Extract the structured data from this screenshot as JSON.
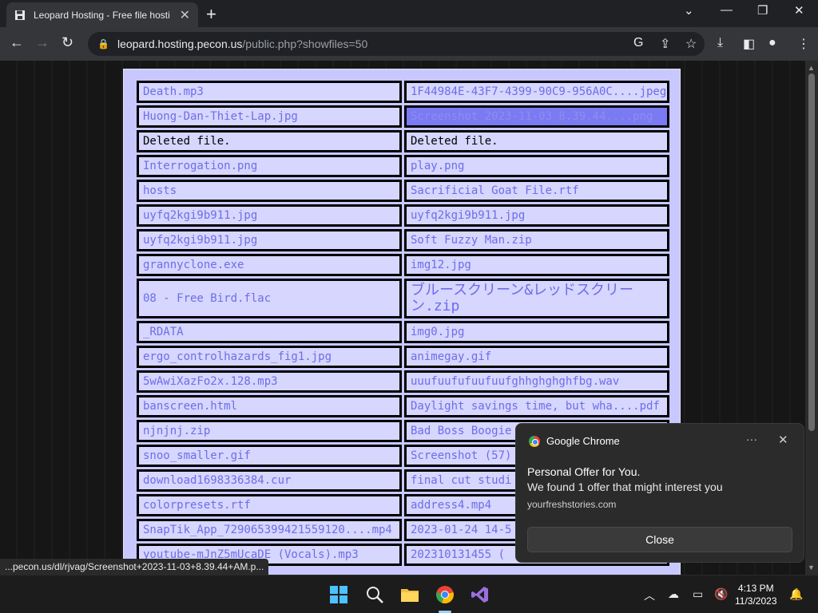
{
  "browser": {
    "tab_title": "Leopard Hosting - Free file hosti",
    "url_host": "leopard.hosting.pecon.us",
    "url_path": "/public.php?showfiles=50",
    "status_url": "...pecon.us/dl/rjvag/Screenshot+2023-11-03+8.39.44+AM.p..."
  },
  "files": {
    "left": [
      "Death.mp3",
      "Huong-Dan-Thiet-Lap.jpg",
      "Deleted file.",
      "Interrogation.png",
      "hosts",
      "uyfq2kgi9b911.jpg",
      "uyfq2kgi9b911.jpg",
      "grannyclone.exe",
      "08 - Free Bird.flac",
      "_RDATA",
      "ergo_controlhazards_fig1.jpg",
      "5wAwiXazFo2x.128.mp3",
      "banscreen.html",
      "njnjnj.zip",
      "snoo_smaller.gif",
      "download1698336384.cur",
      "colorpresets.rtf",
      "SnapTik_App_729065399421559120....mp4",
      "youtube-mJnZ5mUcaDE (Vocals).mp3"
    ],
    "right": [
      "1F44984E-43F7-4399-90C9-956A0C....jpeg",
      "Screenshot 2023-11-03 8.39.44....png",
      "Deleted file.",
      "play.png",
      "Sacrificial Goat File.rtf",
      "uyfq2kgi9b911.jpg",
      "Soft Fuzzy Man.zip",
      "img12.jpg",
      "ブルースクリーン&レッドスクリーン.zip",
      "img0.jpg",
      "animegay.gif",
      "uuufuufufuufuufghhghghghfbg.wav",
      "Daylight savings time, but wha....pdf",
      "Bad Boss Boogie",
      "Screenshot (57)",
      "final cut studi",
      "address4.mp4",
      "2023-01-24 14-5",
      "202310131455 ("
    ]
  },
  "notification": {
    "app": "Google Chrome",
    "more": "···",
    "title": "Personal Offer for You.",
    "body": "We found 1 offer that might interest you",
    "source": "yourfreshstories.com",
    "close_label": "Close"
  },
  "taskbar": {
    "time": "4:13 PM",
    "date": "11/3/2023"
  }
}
